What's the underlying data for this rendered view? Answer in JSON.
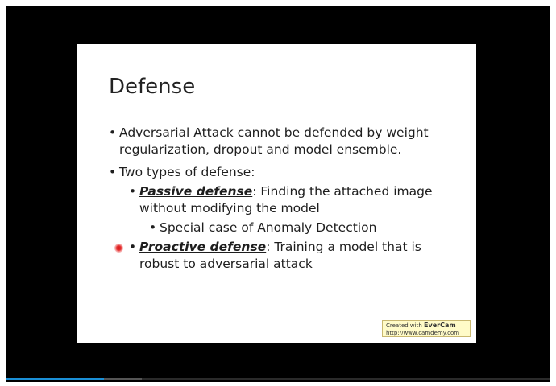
{
  "slide": {
    "title": "Defense",
    "bullets": [
      {
        "level": 1,
        "text": "Adversarial Attack cannot be defended by weight regularization, dropout and model ensemble."
      },
      {
        "level": 1,
        "text": "Two types of defense:"
      },
      {
        "level": 2,
        "emphasis": "Passive defense",
        "text": ": Finding the attached image without modifying the model"
      },
      {
        "level": 3,
        "text": "Special case of Anomaly Detection"
      },
      {
        "level": 2,
        "emphasis": "Proactive defense",
        "text": ": Training a model that is robust to adversarial attack"
      }
    ],
    "bullet_glyph": "•"
  },
  "watermark": {
    "prefix": "Created with ",
    "brand": "EverCam",
    "url": "http://www.camdemy.com"
  },
  "player": {
    "progress_played": 0.18,
    "progress_buffered": 0.25,
    "accent_color": "#1a8fd6"
  }
}
